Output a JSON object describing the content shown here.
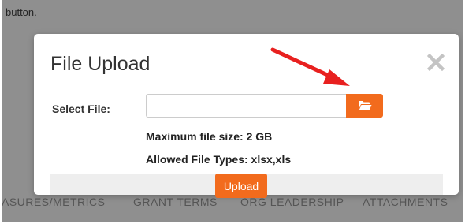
{
  "background": {
    "top_text": "button.",
    "tabs": [
      "ASURES/METRICS",
      "GRANT TERMS",
      "ORG LEADERSHIP",
      "ATTACHMENTS"
    ]
  },
  "modal": {
    "title": "File Upload",
    "close_icon": "close-icon",
    "select_label": "Select File:",
    "file_input_value": "",
    "browse_icon": "folder-open-icon",
    "max_size": "Maximum file size: 2 GB",
    "allowed_types": "Allowed File Types: xlsx,xls",
    "upload_label": "Upload"
  },
  "annotation": {
    "arrow_color": "#e8201f"
  },
  "colors": {
    "accent": "#f26b1d",
    "overlay": "#8f8f8f"
  }
}
